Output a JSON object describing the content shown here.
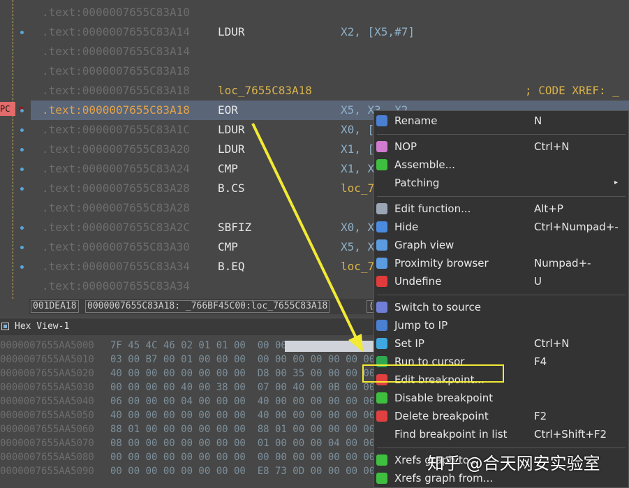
{
  "disasm": {
    "rows": [
      {
        "addr": ".text:0000007655C83A10",
        "mnem": "",
        "ops": "",
        "cmt": "",
        "dot": false
      },
      {
        "addr": ".text:0000007655C83A14",
        "mnem": "LDUR",
        "ops": "X2, [X5,#7]",
        "cmt": "",
        "dot": true
      },
      {
        "addr": ".text:0000007655C83A14",
        "mnem": "",
        "ops": "",
        "cmt": "",
        "dot": false
      },
      {
        "addr": ".text:0000007655C83A18",
        "mnem": "",
        "ops": "",
        "cmt": "",
        "dot": false
      },
      {
        "addr": ".text:0000007655C83A18",
        "mnem": "loc_7655C83A18",
        "ops": "",
        "cmt": "; CODE XREF: _",
        "dot": false
      },
      {
        "addr": ".text:0000007655C83A18",
        "mnem": "EOR",
        "ops": "X5, X3, X2",
        "cmt": "",
        "dot": true
      },
      {
        "addr": ".text:0000007655C83A1C",
        "mnem": "LDUR",
        "ops": "X0, [",
        "cmt": "",
        "dot": true
      },
      {
        "addr": ".text:0000007655C83A20",
        "mnem": "LDUR",
        "ops": "X1, [",
        "cmt": "",
        "dot": true
      },
      {
        "addr": ".text:0000007655C83A24",
        "mnem": "CMP",
        "ops": "X1, X",
        "cmt": "",
        "dot": true
      },
      {
        "addr": ".text:0000007655C83A28",
        "mnem": "B.CS",
        "ops": "loc_7",
        "cmt": "",
        "dot": true
      },
      {
        "addr": ".text:0000007655C83A28",
        "mnem": "",
        "ops": "",
        "cmt": "",
        "dot": false
      },
      {
        "addr": ".text:0000007655C83A2C",
        "mnem": "SBFIZ",
        "ops": "X0, X",
        "cmt": "",
        "dot": true
      },
      {
        "addr": ".text:0000007655C83A30",
        "mnem": "CMP",
        "ops": "X5, X",
        "cmt": "",
        "dot": true
      },
      {
        "addr": ".text:0000007655C83A34",
        "mnem": "B.EQ",
        "ops": "loc_7",
        "cmt": "",
        "dot": true
      },
      {
        "addr": ".text:0000007655C83A34",
        "mnem": "",
        "ops": "",
        "cmt": "",
        "dot": false
      }
    ],
    "pc_label": "PC",
    "current_row": 5
  },
  "status": {
    "offset": "001DEA18",
    "location": "0000007655C83A18: _766BF45C00:loc_7655C83A18",
    "extra": "("
  },
  "hex_view": {
    "title": "Hex View-1",
    "rows": [
      {
        "addr": "0000007655AA5000",
        "bytes": "7F 45 4C 46 02 01 01 00  00 00 00 00 00 00 00"
      },
      {
        "addr": "0000007655AA5010",
        "bytes": "03 00 B7 00 01 00 00 00  00 00 00 00 00 00 00"
      },
      {
        "addr": "0000007655AA5020",
        "bytes": "40 00 00 00 00 00 00 00  D8 00 35 00 00 00 00"
      },
      {
        "addr": "0000007655AA5030",
        "bytes": "00 00 00 00 40 00 38 00  07 00 40 00 0B 00 00"
      },
      {
        "addr": "0000007655AA5040",
        "bytes": "06 00 00 00 04 00 00 00  40 00 00 00 00 00 00"
      },
      {
        "addr": "0000007655AA5050",
        "bytes": "40 00 00 00 00 00 00 00  40 00 00 00 00 00 00"
      },
      {
        "addr": "0000007655AA5060",
        "bytes": "88 01 00 00 00 00 00 00  88 01 00 00 00 00 00"
      },
      {
        "addr": "0000007655AA5070",
        "bytes": "08 00 00 00 00 00 00 00  01 00 00 00 04 00 00"
      },
      {
        "addr": "0000007655AA5080",
        "bytes": "00 00 00 00 00 00 00 00  00 00 00 00 00 00 00"
      },
      {
        "addr": "0000007655AA5090",
        "bytes": "00 00 00 00 00 00 00 00  E8 73 0D 00 00 00 00"
      }
    ]
  },
  "menu": {
    "items": [
      {
        "icon": "rename-icon",
        "label": "Rename",
        "shortcut": "N",
        "color": "#4a7fd1"
      },
      {
        "sep": true
      },
      {
        "icon": "nop-icon",
        "label": "NOP",
        "shortcut": "Ctrl+N",
        "color": "#d07ad0"
      },
      {
        "icon": "assemble-icon",
        "label": "Assemble...",
        "shortcut": "",
        "color": "#3fbf3f"
      },
      {
        "icon": "",
        "label": "Patching",
        "shortcut": "",
        "submenu": true
      },
      {
        "sep": true
      },
      {
        "icon": "function-icon",
        "label": "Edit function...",
        "shortcut": "Alt+P",
        "color": "#9aa6b4"
      },
      {
        "icon": "hide-icon",
        "label": "Hide",
        "shortcut": "Ctrl+Numpad+-",
        "color": "#4a8be0"
      },
      {
        "icon": "graph-view-icon",
        "label": "Graph view",
        "shortcut": "",
        "color": "#5b9be0"
      },
      {
        "icon": "proximity-icon",
        "label": "Proximity browser",
        "shortcut": "Numpad+-",
        "color": "#5b9be0"
      },
      {
        "icon": "undefine-icon",
        "label": "Undefine",
        "shortcut": "U",
        "color": "#e23b3b"
      },
      {
        "sep": true
      },
      {
        "icon": "source-icon",
        "label": "Switch to source",
        "shortcut": "",
        "color": "#6f7fd8"
      },
      {
        "icon": "jump-icon",
        "label": "Jump to IP",
        "shortcut": "",
        "color": "#4a7fd1"
      },
      {
        "icon": "set-ip-icon",
        "label": "Set IP",
        "shortcut": "Ctrl+N",
        "color": "#3fa8e0"
      },
      {
        "icon": "run-to-cursor-icon",
        "label": "Run to cursor",
        "shortcut": "F4",
        "color": "#2fa84f"
      },
      {
        "icon": "edit-breakpoint-icon",
        "label": "Edit breakpoint...",
        "shortcut": "",
        "color": "#e04040"
      },
      {
        "icon": "disable-breakpoint-icon",
        "label": "Disable breakpoint",
        "shortcut": "",
        "color": "#3fbf3f"
      },
      {
        "icon": "delete-breakpoint-icon",
        "label": "Delete breakpoint",
        "shortcut": "F2",
        "color": "#e04040"
      },
      {
        "icon": "",
        "label": "Find breakpoint in list",
        "shortcut": "Ctrl+Shift+F2"
      },
      {
        "sep": true
      },
      {
        "icon": "xrefs-to-icon",
        "label": "Xrefs graph to...",
        "shortcut": "",
        "color": "#3fbf3f"
      },
      {
        "icon": "xrefs-from-icon",
        "label": "Xrefs graph from...",
        "shortcut": "",
        "color": "#3fbf3f"
      }
    ]
  },
  "watermark": "知乎 @合天网安实验室",
  "colors": {
    "highlight": "#f2ea33",
    "arrow": "#f2ea33",
    "current_addr": "#e3a347",
    "label": "#d9b34b"
  }
}
